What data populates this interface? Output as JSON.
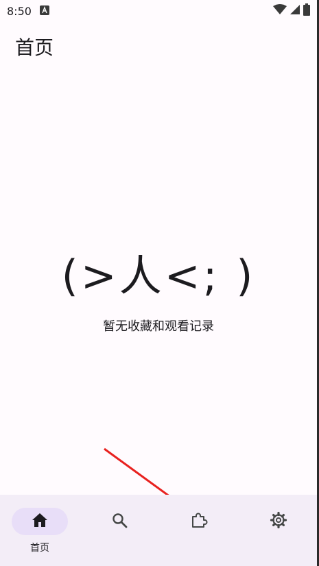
{
  "status_bar": {
    "time": "8:50",
    "icons": [
      "keyboard-icon",
      "wifi-icon",
      "signal-icon",
      "battery-icon"
    ]
  },
  "app_bar": {
    "title": "首页"
  },
  "empty_state": {
    "face": "(>人<; )",
    "message": "暂无收藏和观看记录"
  },
  "bottom_nav": {
    "items": [
      {
        "id": "home",
        "label": "首页",
        "icon": "home-icon",
        "active": true
      },
      {
        "id": "search",
        "label": "",
        "icon": "search-icon",
        "active": false
      },
      {
        "id": "extensions",
        "label": "",
        "icon": "puzzle-icon",
        "active": false
      },
      {
        "id": "settings",
        "label": "",
        "icon": "gear-icon",
        "active": false
      }
    ]
  },
  "colors": {
    "background": "#fffbfe",
    "nav_background": "#f3edf7",
    "active_pill": "#e8def8",
    "text": "#1c1b1f",
    "annotation": "#e8211f"
  }
}
